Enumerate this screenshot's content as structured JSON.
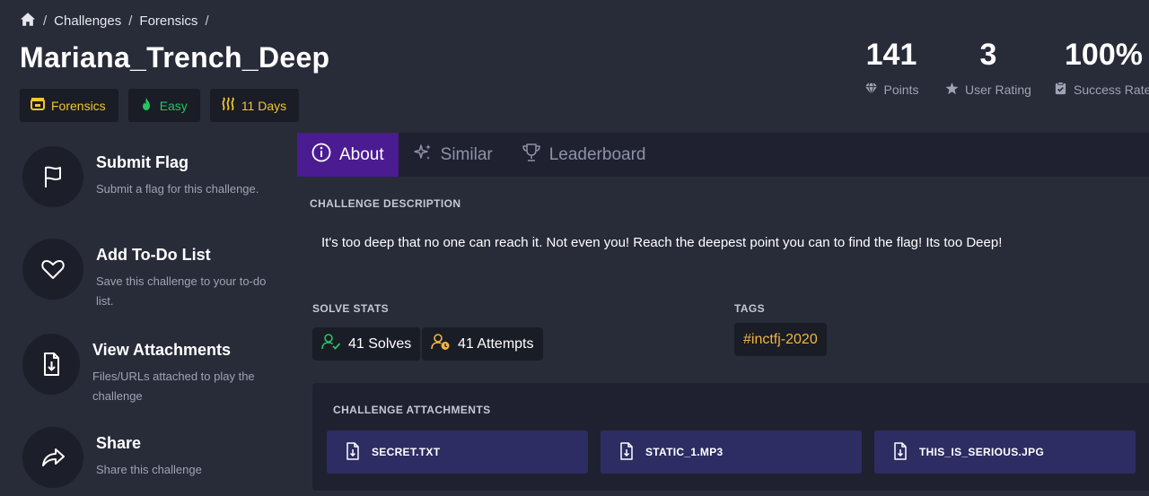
{
  "breadcrumb": {
    "sep": "/",
    "items": [
      "Challenges",
      "Forensics"
    ]
  },
  "title": "Mariana_Trench_Deep",
  "chips": {
    "category": "Forensics",
    "difficulty": "Easy",
    "age": "11 Days"
  },
  "stats": {
    "points": {
      "value": "141",
      "label": "Points"
    },
    "rating": {
      "value": "3",
      "label": "User Rating"
    },
    "success": {
      "value": "100%",
      "label": "Success Rate"
    }
  },
  "sidebar": {
    "items": [
      {
        "title": "Submit Flag",
        "desc": "Submit a flag for this challenge."
      },
      {
        "title": "Add To-Do List",
        "desc": "Save this challenge to your to-do list."
      },
      {
        "title": "View Attachments",
        "desc": "Files/URLs attached to play the challenge"
      },
      {
        "title": "Share",
        "desc": "Share this challenge"
      }
    ]
  },
  "tabs": {
    "about": "About",
    "similar": "Similar",
    "leaderboard": "Leaderboard"
  },
  "description": {
    "heading": "CHALLENGE DESCRIPTION",
    "text": "It's too deep that no one can reach it. Not even you! Reach the deepest point you can to find the flag! Its too Deep!"
  },
  "solve_stats": {
    "heading": "SOLVE STATS",
    "solves": "41 Solves",
    "attempts": "41 Attempts"
  },
  "tags": {
    "heading": "TAGS",
    "items": [
      "#inctfj-2020"
    ]
  },
  "attachments": {
    "heading": "CHALLENGE ATTACHMENTS",
    "files": [
      "SECRET.TXT",
      "STATIC_1.MP3",
      "THIS_IS_SERIOUS.JPG"
    ]
  },
  "colors": {
    "accent": "#4b1b92",
    "category": "#f0c72f",
    "easy": "#27c462",
    "tag": "#f0b640",
    "attachment_bg": "#2d2c63"
  }
}
